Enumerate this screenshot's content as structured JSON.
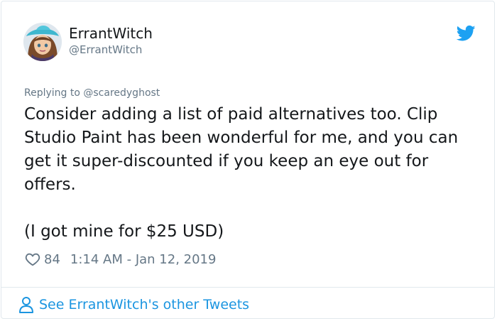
{
  "user": {
    "display_name": "ErrantWitch",
    "handle": "@ErrantWitch"
  },
  "reply_context": "Replying to @scaredyghost",
  "tweet": {
    "paragraphs": [
      "Consider adding a list of paid alternatives too. Clip Studio Paint has been wonderful for me, and you can get it super-discounted if you keep an eye out for offers.",
      "(I got mine for $25 USD)"
    ],
    "likes": "84",
    "timestamp": "1:14 AM - Jan 12, 2019"
  },
  "footer": {
    "link_text": "See ErrantWitch's other Tweets"
  },
  "icons": {
    "bird": "twitter-bird-icon",
    "heart": "heart-icon",
    "person": "person-icon"
  },
  "colors": {
    "twitter_blue": "#1da1f2",
    "link_blue": "#1b95e0",
    "secondary_text": "#657786",
    "primary_text": "#14171a",
    "border": "#e1e8ed"
  }
}
